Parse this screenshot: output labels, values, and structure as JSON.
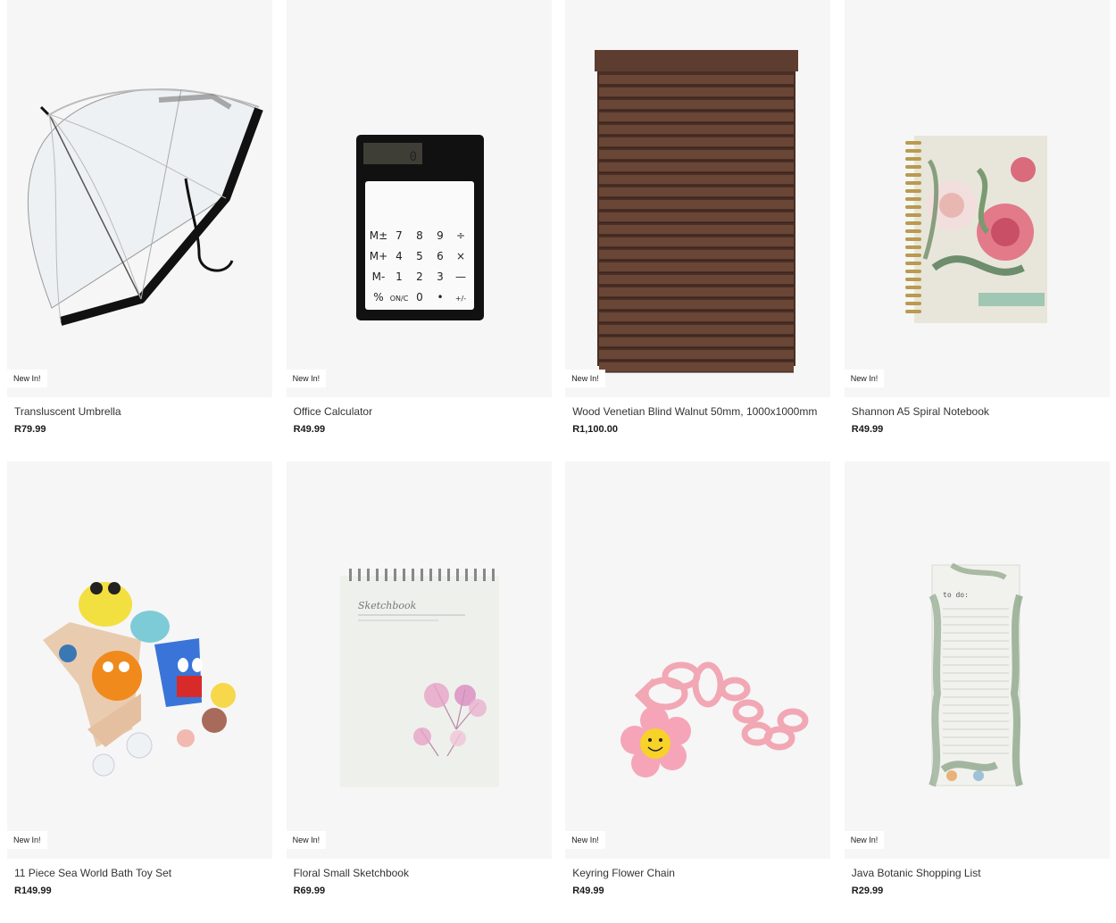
{
  "products": [
    {
      "name": "Transluscent Umbrella",
      "price": "R79.99",
      "badge": "New In!",
      "icon": "umbrella-icon"
    },
    {
      "name": "Office Calculator",
      "price": "R49.99",
      "badge": "New In!",
      "icon": "calculator-icon"
    },
    {
      "name": "Wood Venetian Blind Walnut 50mm, 1000x1000mm",
      "price": "R1,100.00",
      "badge": "New In!",
      "icon": "venetian-blind-icon"
    },
    {
      "name": "Shannon A5 Spiral Notebook",
      "price": "R49.99",
      "badge": "New In!",
      "icon": "notebook-icon"
    },
    {
      "name": "11 Piece Sea World Bath Toy Set",
      "price": "R149.99",
      "badge": "New In!",
      "icon": "bath-toys-icon"
    },
    {
      "name": "Floral Small Sketchbook",
      "price": "R69.99",
      "badge": "New In!",
      "icon": "sketchbook-icon"
    },
    {
      "name": "Keyring Flower Chain",
      "price": "R49.99",
      "badge": "New In!",
      "icon": "keyring-icon"
    },
    {
      "name": "Java Botanic Shopping List",
      "price": "R29.99",
      "badge": "New In!",
      "icon": "shopping-list-icon"
    }
  ],
  "calculator_keys": [
    "M±",
    "7",
    "8",
    "9",
    "÷",
    "M+",
    "4",
    "5",
    "6",
    "×",
    "M-",
    "1",
    "2",
    "3",
    "—",
    "%",
    "ON/C",
    "0",
    "•",
    "+/-"
  ],
  "calculator_display": "0",
  "sketchbook_cover_text": "Sketchbook",
  "shopping_list_header": "to do:",
  "colors": {
    "card_bg": "#f6f6f6",
    "blind": "#5a3a2e",
    "text": "#333333"
  }
}
